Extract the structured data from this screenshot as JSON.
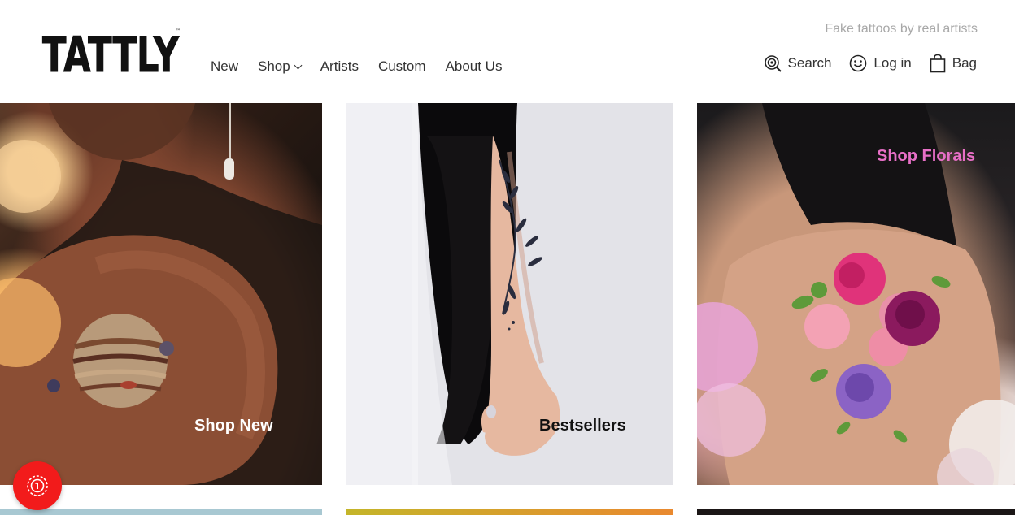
{
  "brand": {
    "logo_text": "TATTLY",
    "tagline": "Fake tattoos by real artists"
  },
  "nav": {
    "items": [
      {
        "label": "New"
      },
      {
        "label": "Shop",
        "has_dropdown": true
      },
      {
        "label": "Artists"
      },
      {
        "label": "Custom"
      },
      {
        "label": "About Us"
      }
    ]
  },
  "utility": {
    "search_label": "Search",
    "search_icon": "search-icon",
    "login_label": "Log in",
    "login_icon": "smiley-icon",
    "bag_label": "Bag",
    "bag_icon": "bag-icon"
  },
  "hero": {
    "panels": [
      {
        "label": "Shop New",
        "label_color": "#ffffff"
      },
      {
        "label": "Bestsellers",
        "label_color": "#111111"
      },
      {
        "label": "Shop Florals",
        "label_color": "#e86fc7"
      }
    ]
  },
  "floating_button": {
    "icon": "badge-icon",
    "color": "#f21b1b"
  }
}
